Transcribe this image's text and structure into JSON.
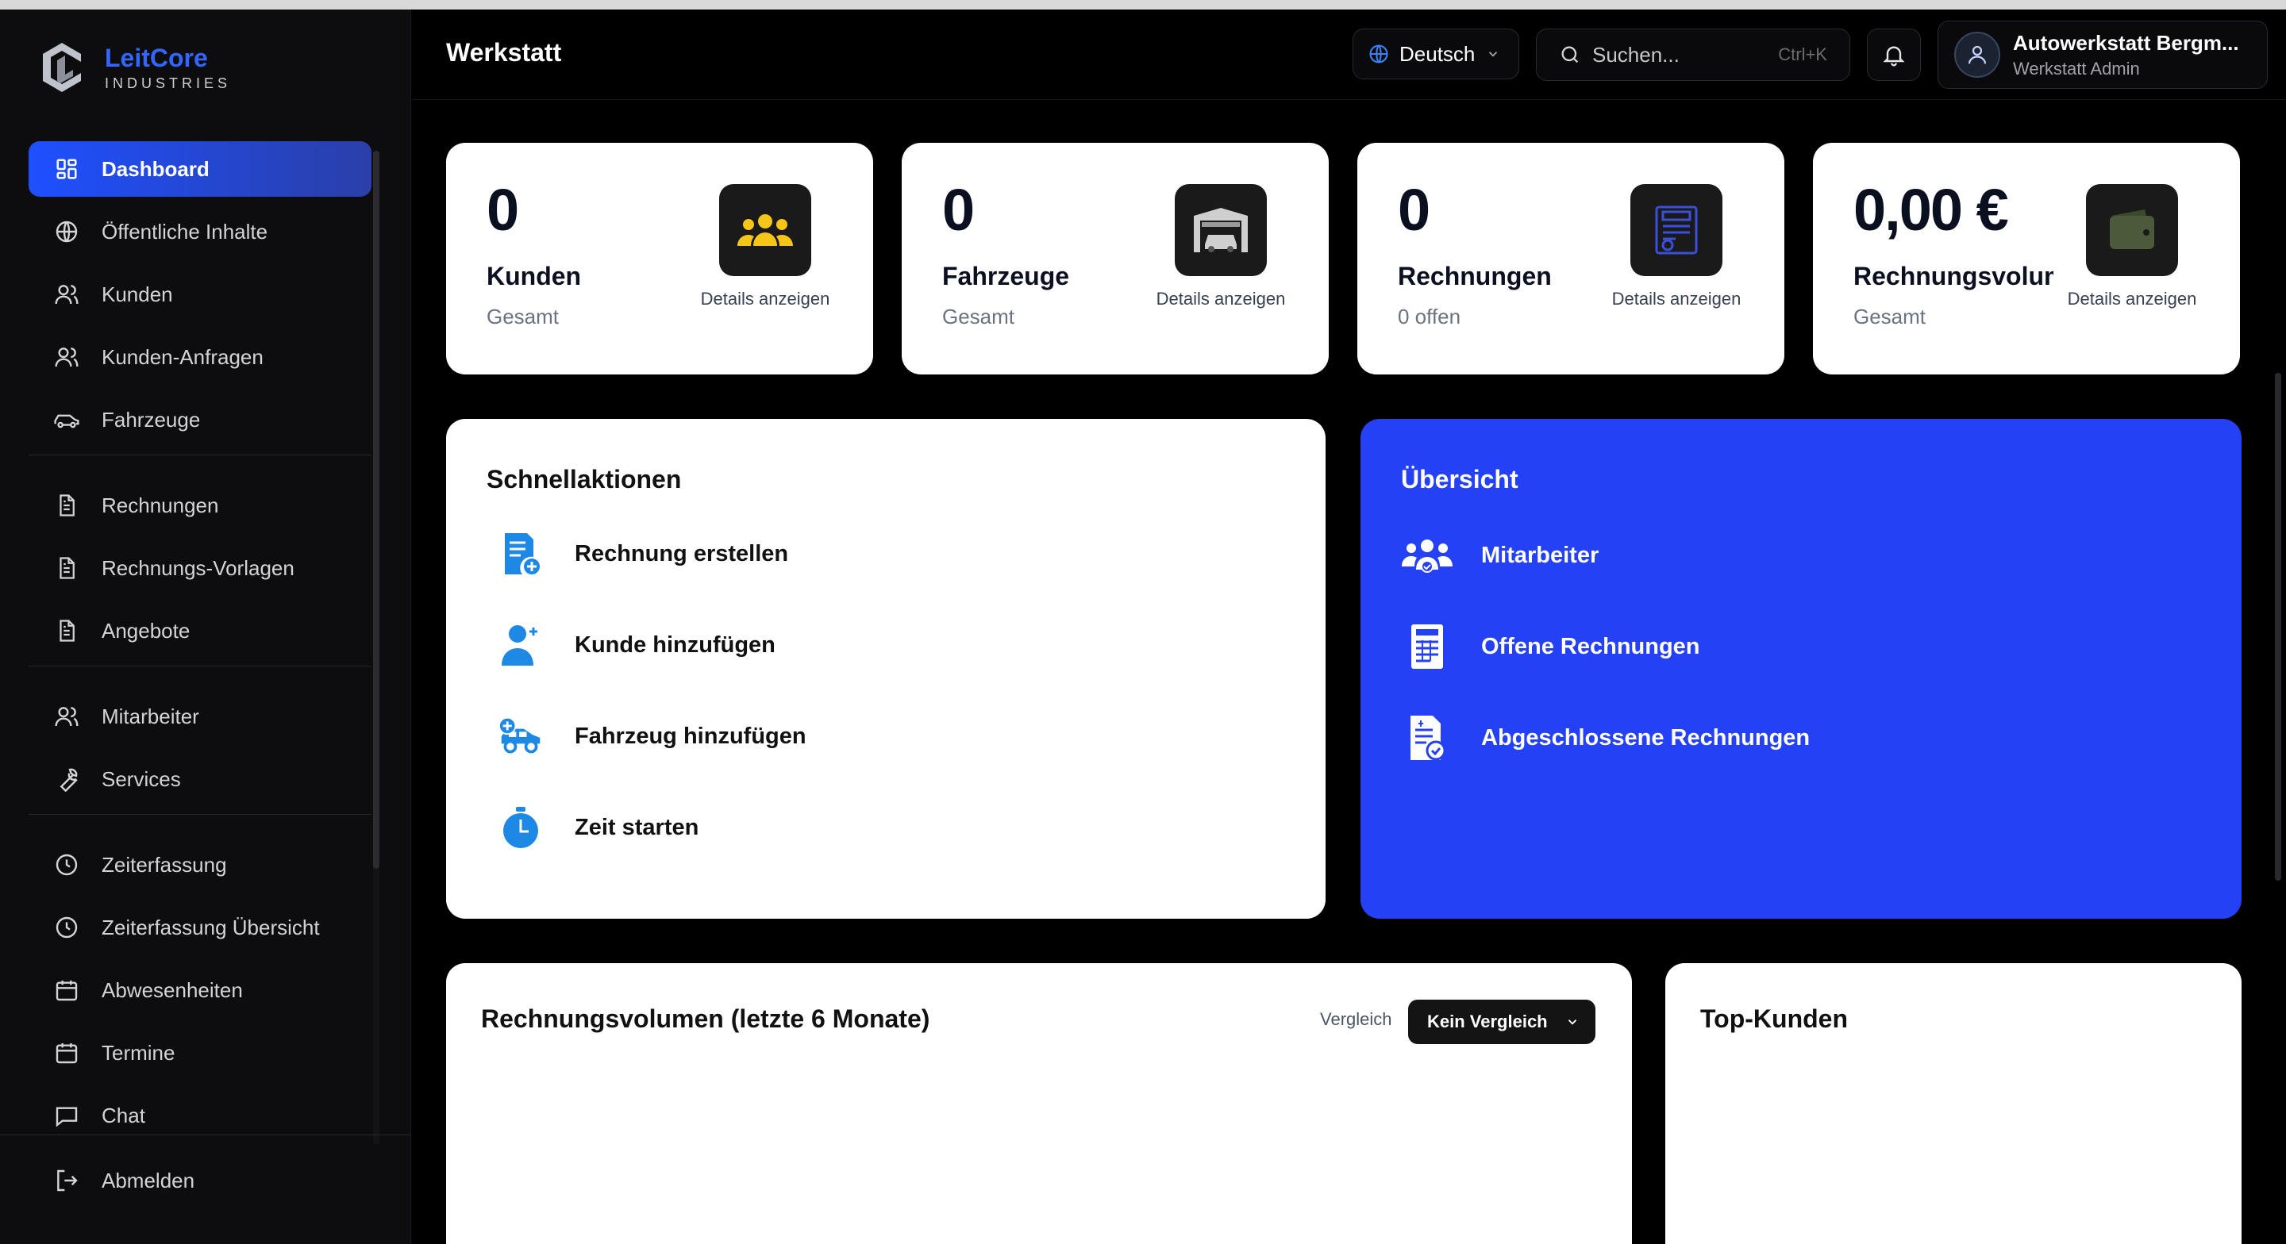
{
  "brand": {
    "name": "LeitCore",
    "subtitle": "INDUSTRIES",
    "accent": "#3366ff"
  },
  "sidebar": {
    "items": [
      {
        "label": "Dashboard",
        "icon": "grid-icon",
        "active": true
      },
      {
        "label": "Öffentliche Inhalte",
        "icon": "globe-icon"
      },
      {
        "label": "Kunden",
        "icon": "users-icon"
      },
      {
        "label": "Kunden-Anfragen",
        "icon": "users-icon"
      },
      {
        "label": "Fahrzeuge",
        "icon": "car-icon"
      },
      {
        "label": "Rechnungen",
        "icon": "document-icon"
      },
      {
        "label": "Rechnungs-Vorlagen",
        "icon": "document-icon"
      },
      {
        "label": "Angebote",
        "icon": "document-icon"
      },
      {
        "label": "Mitarbeiter",
        "icon": "users-icon"
      },
      {
        "label": "Services",
        "icon": "wrench-icon"
      },
      {
        "label": "Zeiterfassung",
        "icon": "clock-icon"
      },
      {
        "label": "Zeiterfassung Übersicht",
        "icon": "clock-icon"
      },
      {
        "label": "Abwesenheiten",
        "icon": "calendar-icon"
      },
      {
        "label": "Termine",
        "icon": "calendar-icon"
      },
      {
        "label": "Chat",
        "icon": "chat-icon"
      }
    ],
    "logout_label": "Abmelden"
  },
  "header": {
    "title": "Werkstatt",
    "language": "Deutsch",
    "search_placeholder": "Suchen...",
    "search_shortcut": "Ctrl+K",
    "user_name": "Autowerkstatt Bergm...",
    "user_role": "Werkstatt Admin"
  },
  "stats": [
    {
      "value": "0",
      "label": "Kunden",
      "sub": "Gesamt",
      "details": "Details anzeigen",
      "icon": "group-icon",
      "icon_color": "#f5c518"
    },
    {
      "value": "0",
      "label": "Fahrzeuge",
      "sub": "Gesamt",
      "details": "Details anzeigen",
      "icon": "garage-icon",
      "icon_color": "#cfcfcf"
    },
    {
      "value": "0",
      "label": "Rechnungen",
      "sub": "0 offen",
      "details": "Details anzeigen",
      "icon": "invoice-icon",
      "icon_color": "#3b4fd8"
    },
    {
      "value": "0,00 €",
      "label": "Rechnungsvolumen",
      "sub": "Gesamt",
      "details": "Details anzeigen",
      "icon": "wallet-icon",
      "icon_color": "#4a5a3a"
    }
  ],
  "quick_actions": {
    "title": "Schnellaktionen",
    "items": [
      {
        "label": "Rechnung erstellen",
        "icon": "invoice-add-icon"
      },
      {
        "label": "Kunde hinzufügen",
        "icon": "user-add-icon"
      },
      {
        "label": "Fahrzeug hinzufügen",
        "icon": "vehicle-add-icon"
      },
      {
        "label": "Zeit starten",
        "icon": "stopwatch-icon"
      }
    ],
    "icon_color": "#1e88e5"
  },
  "overview": {
    "title": "Übersicht",
    "bg_color": "#2541f6",
    "items": [
      {
        "label": "Mitarbeiter",
        "icon": "team-icon"
      },
      {
        "label": "Offene Rechnungen",
        "icon": "invoice-icon"
      },
      {
        "label": "Abgeschlossene Rechnungen",
        "icon": "invoice-check-icon"
      }
    ]
  },
  "chart_panel": {
    "title": "Rechnungsvolumen (letzte 6 Monate)",
    "compare_label": "Vergleich",
    "compare_value": "Kein Vergleich"
  },
  "top_customers": {
    "title": "Top-Kunden"
  }
}
